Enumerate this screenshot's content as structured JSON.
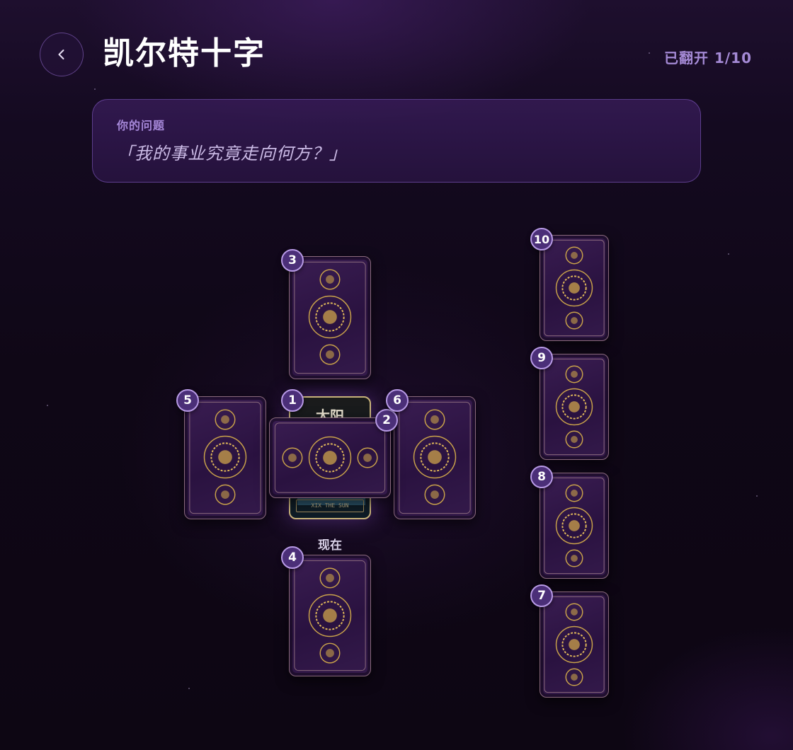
{
  "header": {
    "title": "凯尔特十字",
    "progress": "已翻开 1/10",
    "back_icon": "chevron-left-icon"
  },
  "question": {
    "label": "你的问题",
    "text": "「我的事业究竟走向何方？」"
  },
  "revealed_card": {
    "name": "太阳",
    "caption": "XIX THE SUN",
    "position_label": "现在"
  },
  "cards": [
    {
      "number": "1",
      "revealed": true
    },
    {
      "number": "2",
      "revealed": false
    },
    {
      "number": "3",
      "revealed": false
    },
    {
      "number": "4",
      "revealed": false
    },
    {
      "number": "5",
      "revealed": false
    },
    {
      "number": "6",
      "revealed": false
    },
    {
      "number": "7",
      "revealed": false
    },
    {
      "number": "8",
      "revealed": false
    },
    {
      "number": "9",
      "revealed": false
    },
    {
      "number": "10",
      "revealed": false
    }
  ],
  "colors": {
    "accent": "#a58ad6",
    "badge_fill": "#4b2f78",
    "card_gold": "#c9a24a"
  }
}
